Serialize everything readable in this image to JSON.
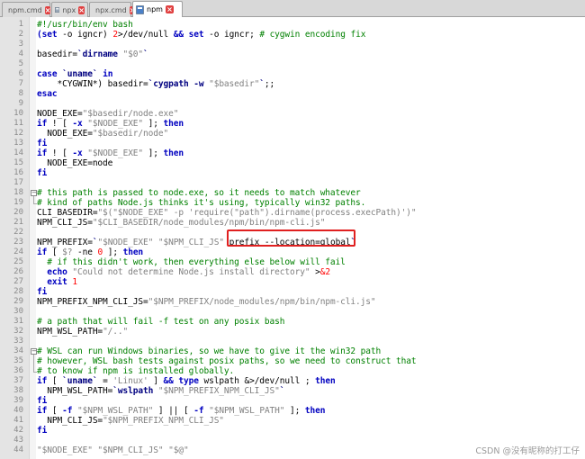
{
  "tabs": [
    {
      "label": "npm.cmd",
      "active": false
    },
    {
      "label": "npx",
      "active": false
    },
    {
      "label": "npx.cmd",
      "active": false
    },
    {
      "label": "npm",
      "active": true
    }
  ],
  "lines": [
    [
      [
        "cmt",
        "#!/usr/bin/env bash"
      ]
    ],
    [
      [
        "kw",
        "(set"
      ],
      [
        "pl",
        " -o igncr) "
      ],
      [
        "num",
        "2"
      ],
      [
        "pl",
        ">/dev/null "
      ],
      [
        "kw",
        "&&"
      ],
      [
        "pl",
        " "
      ],
      [
        "kw",
        "set"
      ],
      [
        "pl",
        " -o igncr; "
      ],
      [
        "cmt",
        "# cygwin encoding fix"
      ]
    ],
    [],
    [
      [
        "pl",
        "basedir="
      ],
      [
        "bt",
        "`dirname "
      ],
      [
        "str",
        "\"$0\""
      ],
      [
        "bt",
        "`"
      ]
    ],
    [],
    [
      [
        "kw",
        "case"
      ],
      [
        "pl",
        " "
      ],
      [
        "bt",
        "`uname`"
      ],
      [
        "pl",
        " "
      ],
      [
        "kw",
        "in"
      ]
    ],
    [
      [
        "pl",
        "    *CYGWIN*) basedir="
      ],
      [
        "bt",
        "`cygpath -w "
      ],
      [
        "str",
        "\"$basedir\""
      ],
      [
        "bt",
        "`"
      ],
      [
        "pl",
        ";;"
      ]
    ],
    [
      [
        "kw",
        "esac"
      ]
    ],
    [],
    [
      [
        "pl",
        "NODE_EXE="
      ],
      [
        "str",
        "\"$basedir/node.exe\""
      ]
    ],
    [
      [
        "kw",
        "if"
      ],
      [
        "pl",
        " ! [ "
      ],
      [
        "kw",
        "-x"
      ],
      [
        "pl",
        " "
      ],
      [
        "str",
        "\"$NODE_EXE\""
      ],
      [
        "pl",
        " ]; "
      ],
      [
        "kw",
        "then"
      ]
    ],
    [
      [
        "pl",
        "  NODE_EXE="
      ],
      [
        "str",
        "\"$basedir/node\""
      ]
    ],
    [
      [
        "kw",
        "fi"
      ]
    ],
    [
      [
        "kw",
        "if"
      ],
      [
        "pl",
        " ! [ "
      ],
      [
        "kw",
        "-x"
      ],
      [
        "pl",
        " "
      ],
      [
        "str",
        "\"$NODE_EXE\""
      ],
      [
        "pl",
        " ]; "
      ],
      [
        "kw",
        "then"
      ]
    ],
    [
      [
        "pl",
        "  NODE_EXE=node"
      ]
    ],
    [
      [
        "kw",
        "fi"
      ]
    ],
    [],
    [
      [
        "cmt",
        "# this path is passed to node.exe, so it needs to match whatever"
      ]
    ],
    [
      [
        "cmt",
        "# kind of paths Node.js thinks it's using, typically win32 paths."
      ]
    ],
    [
      [
        "pl",
        "CLI_BASEDIR="
      ],
      [
        "str",
        "\"$(\"$NODE_EXE\" -p 'require(\"path\").dirname(process.execPath)')\""
      ]
    ],
    [
      [
        "pl",
        "NPM_CLI_JS="
      ],
      [
        "str",
        "\"$CLI_BASEDIR/node_modules/npm/bin/npm-cli.js\""
      ]
    ],
    [],
    [
      [
        "pl",
        "NPM_PREFIX="
      ],
      [
        "bt",
        "`"
      ],
      [
        "str",
        "\"$NODE_EXE\" \"$NPM_CLI_JS\""
      ],
      [
        "pl",
        " prefix --location=global"
      ],
      [
        "bt",
        "`"
      ]
    ],
    [
      [
        "kw",
        "if"
      ],
      [
        "pl",
        " [ "
      ],
      [
        "str",
        "$?"
      ],
      [
        "pl",
        " -ne "
      ],
      [
        "num",
        "0"
      ],
      [
        "pl",
        " ]; "
      ],
      [
        "kw",
        "then"
      ]
    ],
    [
      [
        "cmt",
        "  # if this didn't work, then everything else below will fail"
      ]
    ],
    [
      [
        "pl",
        "  "
      ],
      [
        "kw",
        "echo"
      ],
      [
        "pl",
        " "
      ],
      [
        "str",
        "\"Could not determine Node.js install directory\""
      ],
      [
        "pl",
        " >"
      ],
      [
        "num",
        "&2"
      ]
    ],
    [
      [
        "pl",
        "  "
      ],
      [
        "kw",
        "exit"
      ],
      [
        "pl",
        " "
      ],
      [
        "num",
        "1"
      ]
    ],
    [
      [
        "kw",
        "fi"
      ]
    ],
    [
      [
        "pl",
        "NPM_PREFIX_NPM_CLI_JS="
      ],
      [
        "str",
        "\"$NPM_PREFIX/node_modules/npm/bin/npm-cli.js\""
      ]
    ],
    [],
    [
      [
        "cmt",
        "# a path that will fail -f test on any posix bash"
      ]
    ],
    [
      [
        "pl",
        "NPM_WSL_PATH="
      ],
      [
        "str",
        "\"/..\""
      ]
    ],
    [],
    [
      [
        "cmt",
        "# WSL can run Windows binaries, so we have to give it the win32 path"
      ]
    ],
    [
      [
        "cmt",
        "# however, WSL bash tests against posix paths, so we need to construct that"
      ]
    ],
    [
      [
        "cmt",
        "# to know if npm is installed globally."
      ]
    ],
    [
      [
        "kw",
        "if"
      ],
      [
        "pl",
        " [ "
      ],
      [
        "bt",
        "`uname`"
      ],
      [
        "pl",
        " = "
      ],
      [
        "str",
        "'Linux'"
      ],
      [
        "pl",
        " ] "
      ],
      [
        "kw",
        "&&"
      ],
      [
        "pl",
        " "
      ],
      [
        "kw",
        "type"
      ],
      [
        "pl",
        " wslpath &>/dev/null ; "
      ],
      [
        "kw",
        "then"
      ]
    ],
    [
      [
        "pl",
        "  NPM_WSL_PATH="
      ],
      [
        "bt",
        "`wslpath "
      ],
      [
        "str",
        "\"$NPM_PREFIX_NPM_CLI_JS\""
      ],
      [
        "bt",
        "`"
      ]
    ],
    [
      [
        "kw",
        "fi"
      ]
    ],
    [
      [
        "kw",
        "if"
      ],
      [
        "pl",
        " [ "
      ],
      [
        "kw",
        "-f"
      ],
      [
        "pl",
        " "
      ],
      [
        "str",
        "\"$NPM_WSL_PATH\""
      ],
      [
        "pl",
        " ] || [ "
      ],
      [
        "kw",
        "-f"
      ],
      [
        "pl",
        " "
      ],
      [
        "str",
        "\"$NPM_WSL_PATH\""
      ],
      [
        "pl",
        " ]; "
      ],
      [
        "kw",
        "then"
      ]
    ],
    [
      [
        "pl",
        "  NPM_CLI_JS="
      ],
      [
        "str",
        "\"$NPM_PREFIX_NPM_CLI_JS\""
      ]
    ],
    [
      [
        "kw",
        "fi"
      ]
    ],
    [],
    [
      [
        "str",
        "\"$NODE_EXE\" \"$NPM_CLI_JS\" \"$@\""
      ]
    ]
  ],
  "watermark": "CSDN @没有昵称的打工仔",
  "colors": {
    "keyword": "#0000c0",
    "string": "#808080",
    "comment": "#008000",
    "backtick": "#000080",
    "number": "#ff0000",
    "highlight_box": "#e02020"
  }
}
